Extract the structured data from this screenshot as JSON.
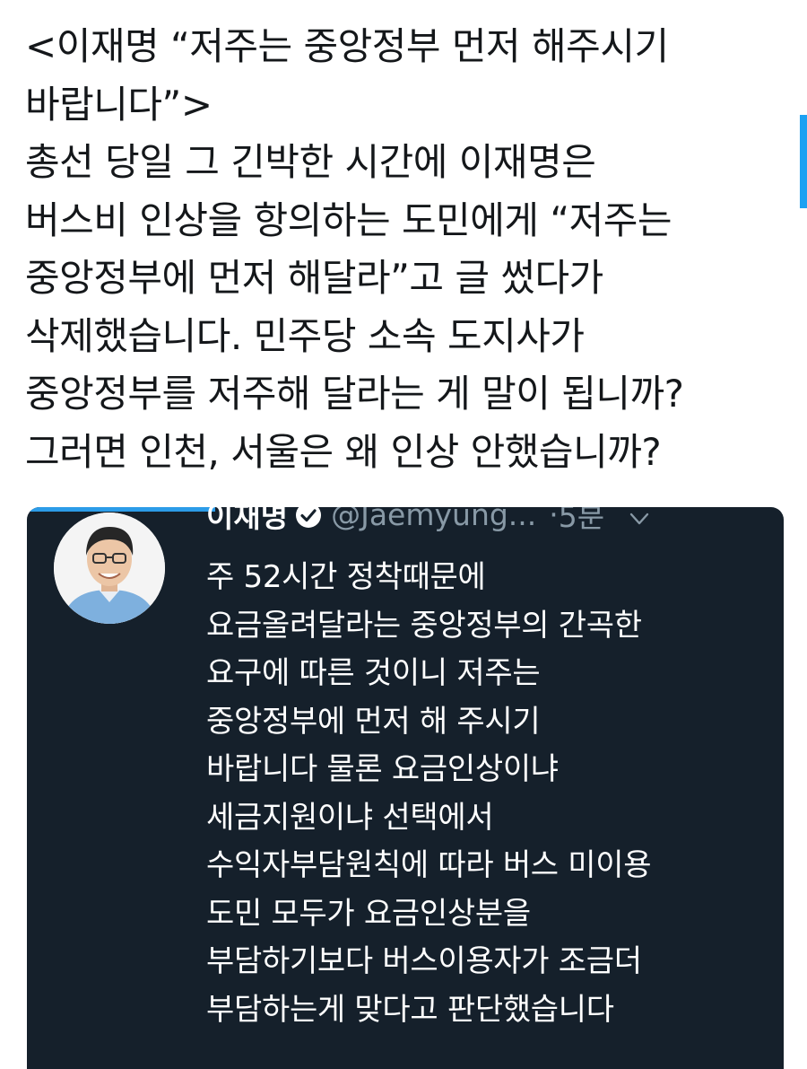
{
  "post": {
    "lines": [
      "<이재명 “저주는 중앙정부 먼저 해주시기",
      "바랍니다”>",
      "총선 당일 그 긴박한 시간에 이재명은",
      "버스비 인상을 항의하는 도민에게 “저주는",
      "중앙정부에 먼저 해달라”고 글 썼다가",
      "삭제했습니다. 민주당 소속 도지사가",
      "중앙정부를 저주해 달라는 게 말이 됩니까?",
      "그러면 인천, 서울은 왜 인상 안했습니까?"
    ]
  },
  "embedded_tweet": {
    "author_name": "이재명",
    "handle": "@Jaemyung...",
    "separator": "·",
    "time": "5분",
    "avatar_icon": "profile-photo",
    "verified_icon": "verified-badge-icon",
    "menu_icon": "chevron-down-icon",
    "lines": [
      "주 52시간 정착때문에",
      "요금올려달라는 중앙정부의 간곡한",
      "요구에 따른 것이니 저주는",
      "중앙정부에 먼저 해 주시기",
      "바랍니다 물론 요금인상이냐",
      "세금지원이냐 선택에서",
      "수익자부담원칙에 따라 버스 미이용",
      "도민 모두가 요금인상분을",
      "부담하기보다 버스이용자가 조금더",
      "부담하는게 맞다고 판단했습니다"
    ]
  },
  "colors": {
    "page_background": "#ffffff",
    "text": "#14171a",
    "embed_background": "#15202b",
    "accent": "#1da1f2",
    "muted": "#8899a6"
  }
}
